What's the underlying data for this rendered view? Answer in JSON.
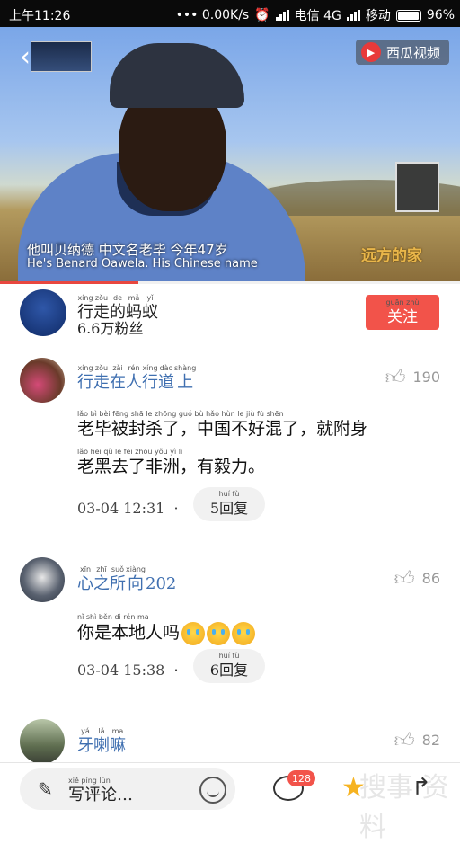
{
  "status_bar": {
    "time": "上午11:26",
    "network_speed": "••• 0.00K/s",
    "carrier1": "电信 4G",
    "carrier2": "移动",
    "battery": "96%"
  },
  "video": {
    "brand": "西瓜视频",
    "subtitle_cn": "他叫贝纳德 中文名老毕 今年47岁",
    "subtitle_en": "He's Benard Oawela. His Chinese name",
    "watermark": "远方的家",
    "progress_fraction": 0.3
  },
  "author": {
    "name_chars": [
      "行",
      "走",
      "的",
      "蚂",
      "蚁"
    ],
    "name_pinyin": [
      "xíng",
      "zǒu",
      "de",
      "mǎ",
      "yǐ"
    ],
    "fans": "6.6万粉丝",
    "follow_label": "关注",
    "follow_pinyin": "guān zhù"
  },
  "comments": [
    {
      "user_chars": [
        "行",
        "走",
        "在",
        "人",
        "行",
        "道",
        "上"
      ],
      "user_pinyin": [
        "xíng",
        "zǒu",
        "zài",
        "rén",
        "xíng",
        "dào",
        "shàng"
      ],
      "likes": "190",
      "line1": "老毕被封杀了，中国不好混了，就附身",
      "line1_pinyin": "lǎo bì bèi fēng shā le   zhōng guó bù hǎo hùn le   jiù fù shēn",
      "line2": "老黑去了非洲，有毅力。",
      "line2_pinyin": "lǎo hēi qù le fēi zhōu   yǒu yì lì",
      "time": "03-04 12:31",
      "replies": "5回复",
      "replies_pinyin": "huí fù"
    },
    {
      "user_chars": [
        "心",
        "之",
        "所",
        "向",
        "2",
        "0",
        "2"
      ],
      "user_pinyin": [
        "xīn",
        "zhī",
        "suǒ",
        "xiàng",
        "",
        "",
        ""
      ],
      "likes": "86",
      "line1": "你是本地人吗",
      "line1_pinyin": "nǐ shì běn dì rén ma",
      "time": "03-04 15:38",
      "replies": "6回复",
      "replies_pinyin": "huí fù"
    },
    {
      "user_chars": [
        "牙",
        "喇",
        "嘛"
      ],
      "user_pinyin": [
        "yá",
        "lǎ",
        "ma"
      ],
      "likes": "82"
    }
  ],
  "bottom_bar": {
    "placeholder": "写评论…",
    "placeholder_pinyin": "xiě píng lùn",
    "comment_count": "128",
    "icons": [
      "pen-icon",
      "smile-icon",
      "comment-icon",
      "star-icon",
      "share-icon"
    ],
    "watermark": "搜事·资料"
  },
  "colors": {
    "accent": "#f2534a",
    "username": "#3f6fb0",
    "star": "#f6b321"
  }
}
